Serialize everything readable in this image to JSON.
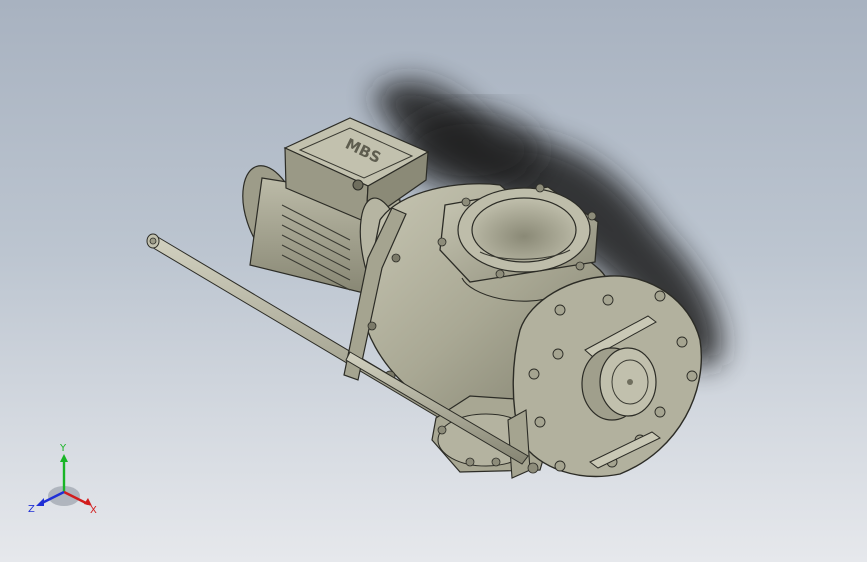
{
  "viewport": {
    "background_top": "#a8b2c0",
    "background_bottom": "#e6e8ec"
  },
  "model": {
    "motor_plate_text": "MBS",
    "part_color": "#a8a793",
    "edge_color": "#2c2c26",
    "shadow_color": "#1a1a1a"
  },
  "triad": {
    "x_label": "X",
    "y_label": "Y",
    "z_label": "Z",
    "x_color": "#d21d1d",
    "y_color": "#19b526",
    "z_color": "#1f2fd6"
  }
}
